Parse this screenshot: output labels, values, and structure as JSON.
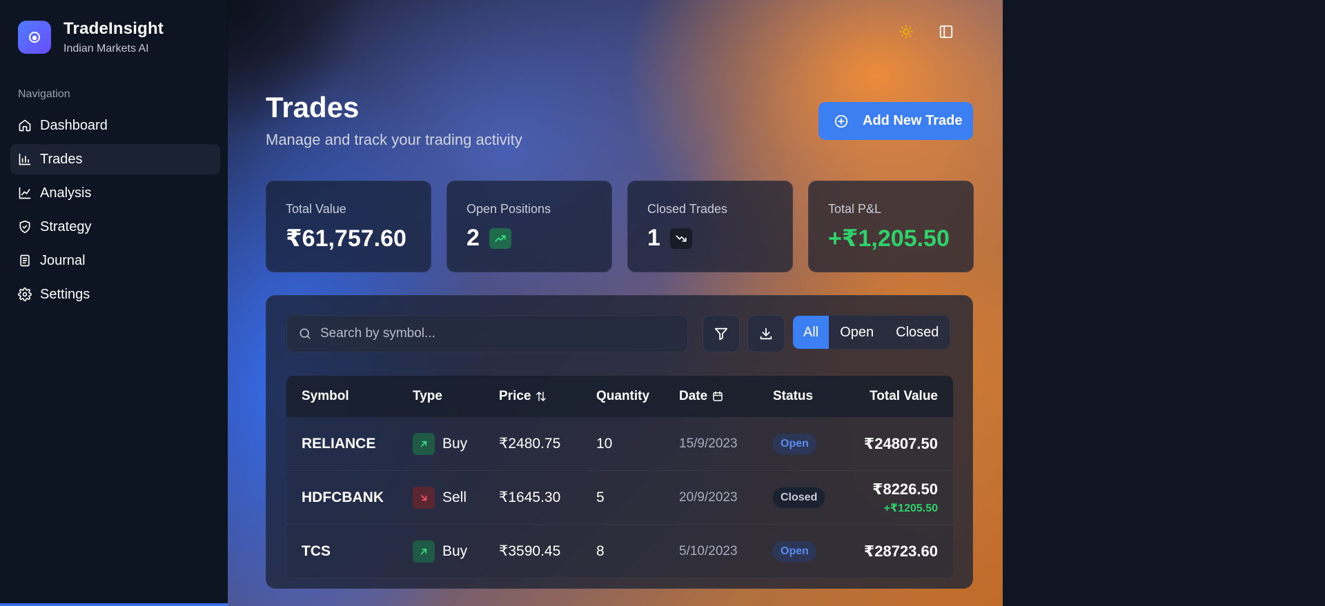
{
  "brand": {
    "title": "TradeInsight",
    "subtitle": "Indian Markets AI"
  },
  "nav": {
    "label": "Navigation",
    "items": [
      {
        "label": "Dashboard",
        "icon": "home-icon",
        "active": false
      },
      {
        "label": "Trades",
        "icon": "bar-chart-icon",
        "active": true
      },
      {
        "label": "Analysis",
        "icon": "line-chart-icon",
        "active": false
      },
      {
        "label": "Strategy",
        "icon": "shield-icon",
        "active": false
      },
      {
        "label": "Journal",
        "icon": "book-icon",
        "active": false
      },
      {
        "label": "Settings",
        "icon": "gear-icon",
        "active": false
      }
    ]
  },
  "header": {
    "title": "Trades",
    "subtitle": "Manage and track your trading activity",
    "add_button": "Add New Trade"
  },
  "stats": [
    {
      "label": "Total Value",
      "value": "₹61,757.60"
    },
    {
      "label": "Open Positions",
      "value": "2",
      "badge": "trend-up-icon"
    },
    {
      "label": "Closed Trades",
      "value": "1",
      "badge": "trend-down-icon"
    },
    {
      "label": "Total P&L",
      "value": "+₹1,205.50"
    }
  ],
  "search": {
    "placeholder": "Search by symbol..."
  },
  "filters": {
    "all": "All",
    "open": "Open",
    "closed": "Closed",
    "active": "All"
  },
  "table": {
    "headers": {
      "symbol": "Symbol",
      "type": "Type",
      "price": "Price",
      "quantity": "Quantity",
      "date": "Date",
      "status": "Status",
      "total": "Total Value"
    },
    "rows": [
      {
        "symbol": "RELIANCE",
        "type": "Buy",
        "price": "₹2480.75",
        "quantity": "10",
        "date": "15/9/2023",
        "status": "Open",
        "total": "₹24807.50",
        "pnl": ""
      },
      {
        "symbol": "HDFCBANK",
        "type": "Sell",
        "price": "₹1645.30",
        "quantity": "5",
        "date": "20/9/2023",
        "status": "Closed",
        "total": "₹8226.50",
        "pnl": "+₹1205.50"
      },
      {
        "symbol": "TCS",
        "type": "Buy",
        "price": "₹3590.45",
        "quantity": "8",
        "date": "5/10/2023",
        "status": "Open",
        "total": "₹28723.60",
        "pnl": ""
      }
    ]
  },
  "colors": {
    "accent": "#3b7ff2",
    "positive": "#2fd16b",
    "negative": "#e05263",
    "theme_icon": "#f5b300"
  }
}
